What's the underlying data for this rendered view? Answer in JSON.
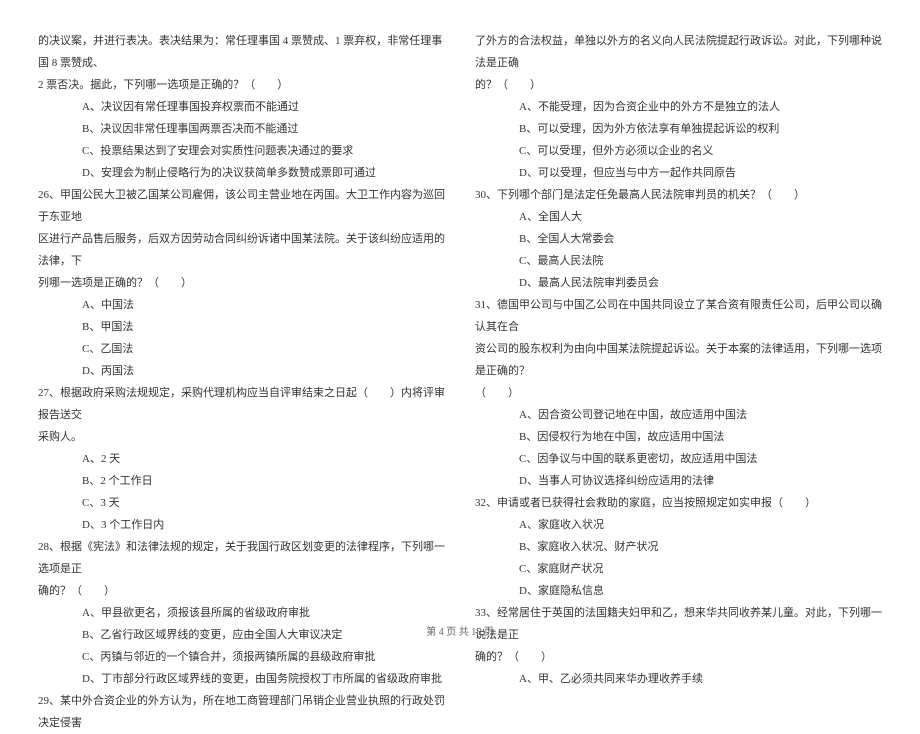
{
  "left": {
    "intro1": "的决议案，并进行表决。表决结果为：常任理事国 4 票赞成、1 票弃权，非常任理事国 8 票赞成、",
    "intro2": "2 票否决。据此，下列哪一选项是正确的？（　　）",
    "q25": {
      "a": "A、决议因有常任理事国投弃权票而不能通过",
      "b": "B、决议因非常任理事国两票否决而不能通过",
      "c": "C、投票结果达到了安理会对实质性问题表决通过的要求",
      "d": "D、安理会为制止侵略行为的决议获简单多数赞成票即可通过"
    },
    "q26": {
      "stem1": "26、甲国公民大卫被乙国某公司雇佣，该公司主营业地在丙国。大卫工作内容为巡回于东亚地",
      "stem2": "区进行产品售后服务，后双方因劳动合同纠纷诉诸中国某法院。关于该纠纷应适用的法律，下",
      "stem3": "列哪一选项是正确的？（　　）",
      "a": "A、中国法",
      "b": "B、甲国法",
      "c": "C、乙国法",
      "d": "D、丙国法"
    },
    "q27": {
      "stem1": "27、根据政府采购法规规定，采购代理机构应当自评审结束之日起（　　）内将评审报告送交",
      "stem2": "采购人。",
      "a": "A、2 天",
      "b": "B、2 个工作日",
      "c": "C、3 天",
      "d": "D、3 个工作日内"
    },
    "q28": {
      "stem1": "28、根据《宪法》和法律法规的规定，关于我国行政区划变更的法律程序，下列哪一选项是正",
      "stem2": "确的？（　　）",
      "a": "A、甲县欲更名，须报该县所属的省级政府审批",
      "b": "B、乙省行政区域界线的变更，应由全国人大审议决定",
      "c": "C、丙镇与邻近的一个镇合并，须报两镇所属的县级政府审批",
      "d": "D、丁市部分行政区域界线的变更，由国务院授权丁市所属的省级政府审批"
    },
    "q29": {
      "stem1": "29、某中外合资企业的外方认为，所在地工商管理部门吊销企业营业执照的行政处罚决定侵害"
    }
  },
  "right": {
    "q29cont": {
      "stem1": "了外方的合法权益，单独以外方的名义向人民法院提起行政诉讼。对此，下列哪种说法是正确",
      "stem2": "的？（　　）",
      "a": "A、不能受理，因为合资企业中的外方不是独立的法人",
      "b": "B、可以受理，因为外方依法享有单独提起诉讼的权利",
      "c": "C、可以受理，但外方必须以企业的名义",
      "d": "D、可以受理，但应当与中方一起作共同原告"
    },
    "q30": {
      "stem": "30、下列哪个部门是法定任免最高人民法院审判员的机关？（　　）",
      "a": "A、全国人大",
      "b": "B、全国人大常委会",
      "c": "C、最高人民法院",
      "d": "D、最高人民法院审判委员会"
    },
    "q31": {
      "stem1": "31、德国甲公司与中国乙公司在中国共同设立了某合资有限责任公司，后甲公司以确认其在合",
      "stem2": "资公司的股东权利为由向中国某法院提起诉讼。关于本案的法律适用，下列哪一选项是正确的？",
      "stem3": "（　　）",
      "a": "A、因合资公司登记地在中国，故应适用中国法",
      "b": "B、因侵权行为地在中国，故应适用中国法",
      "c": "C、因争议与中国的联系更密切，故应适用中国法",
      "d": "D、当事人可协议选择纠纷应适用的法律"
    },
    "q32": {
      "stem": "32、申请或者已获得社会救助的家庭，应当按照规定如实申报（　　）",
      "a": "A、家庭收入状况",
      "b": "B、家庭收入状况、财产状况",
      "c": "C、家庭财产状况",
      "d": "D、家庭隐私信息"
    },
    "q33": {
      "stem1": "33、经常居住于英国的法国籍夫妇甲和乙，想来华共同收养某儿童。对此，下列哪一说法是正",
      "stem2": "确的？（　　）",
      "a": "A、甲、乙必须共同来华办理收养手续"
    }
  },
  "footer": "第 4 页 共 15 页"
}
